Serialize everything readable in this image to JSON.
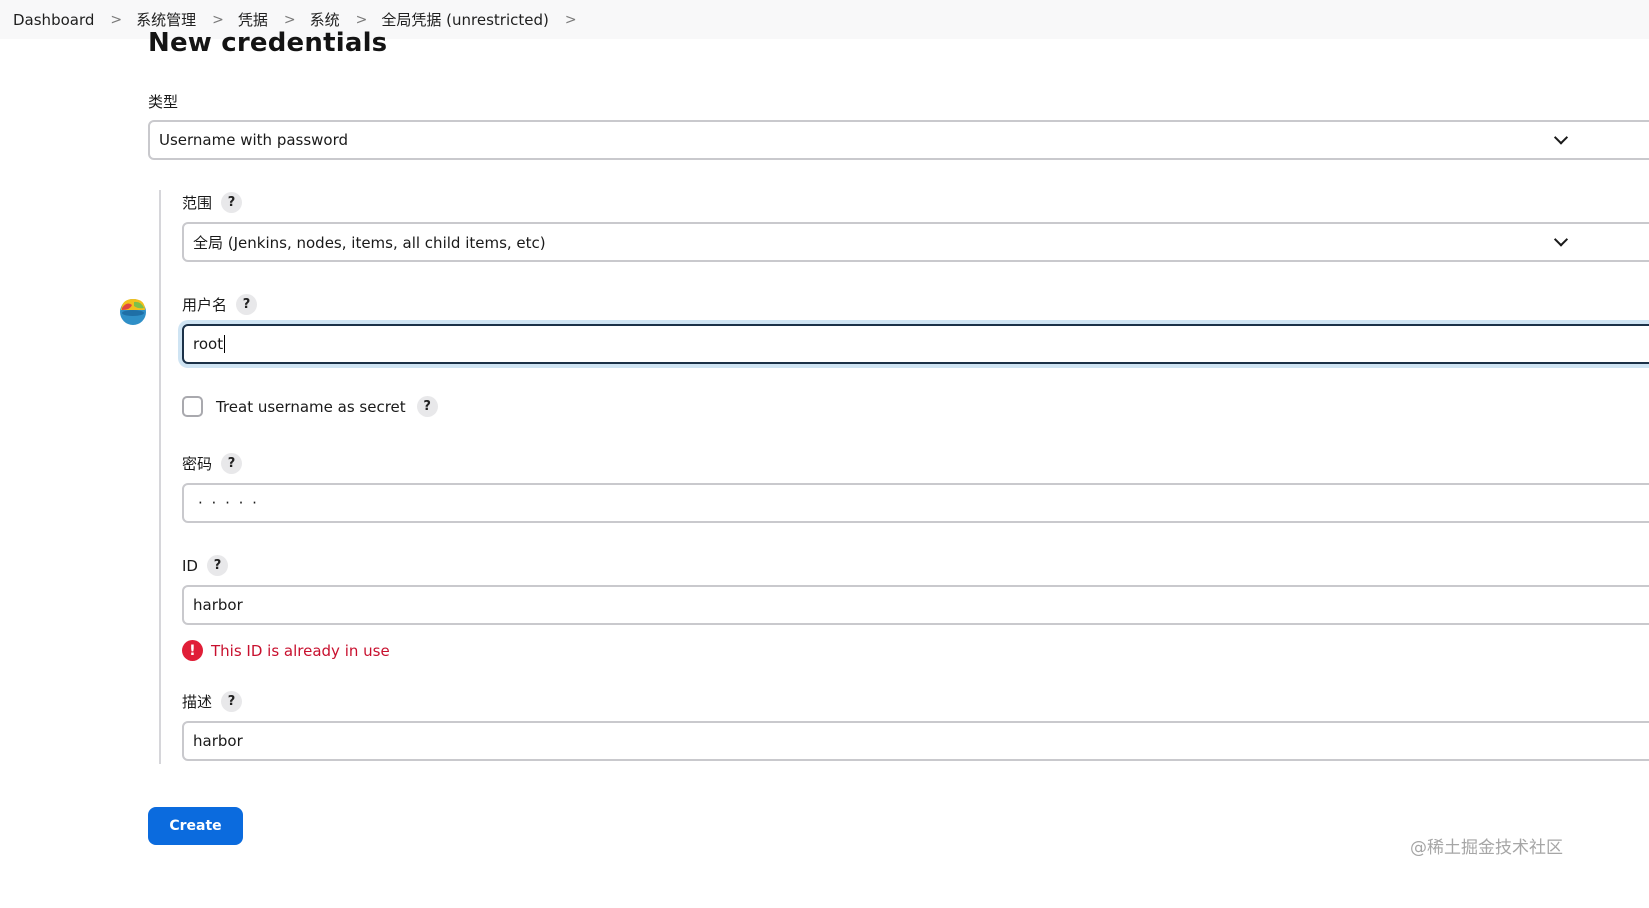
{
  "breadcrumb": {
    "items": [
      "Dashboard",
      "系统管理",
      "凭据",
      "系统",
      "全局凭据 (unrestricted)"
    ],
    "separator": ">"
  },
  "page": {
    "title": "New credentials"
  },
  "form": {
    "kind": {
      "label": "类型",
      "value": "Username with password"
    },
    "scope": {
      "label": "范围",
      "value": "全局 (Jenkins, nodes, items, all child items, etc)"
    },
    "username": {
      "label": "用户名",
      "value": "root"
    },
    "secret_toggle": {
      "label": "Treat username as secret",
      "checked": false
    },
    "password": {
      "label": "密码",
      "masked_value": "· · · · ·"
    },
    "id": {
      "label": "ID",
      "value": "harbor",
      "error": "This ID is already in use",
      "error_glyph": "!"
    },
    "description": {
      "label": "描述",
      "value": "harbor"
    },
    "help_glyph": "?"
  },
  "actions": {
    "create_label": "Create"
  },
  "watermark": "@稀土掘金技术社区",
  "colors": {
    "primary": "#0b6bde",
    "error": "#c8102e",
    "focus_ring": "#cfe4f3"
  }
}
